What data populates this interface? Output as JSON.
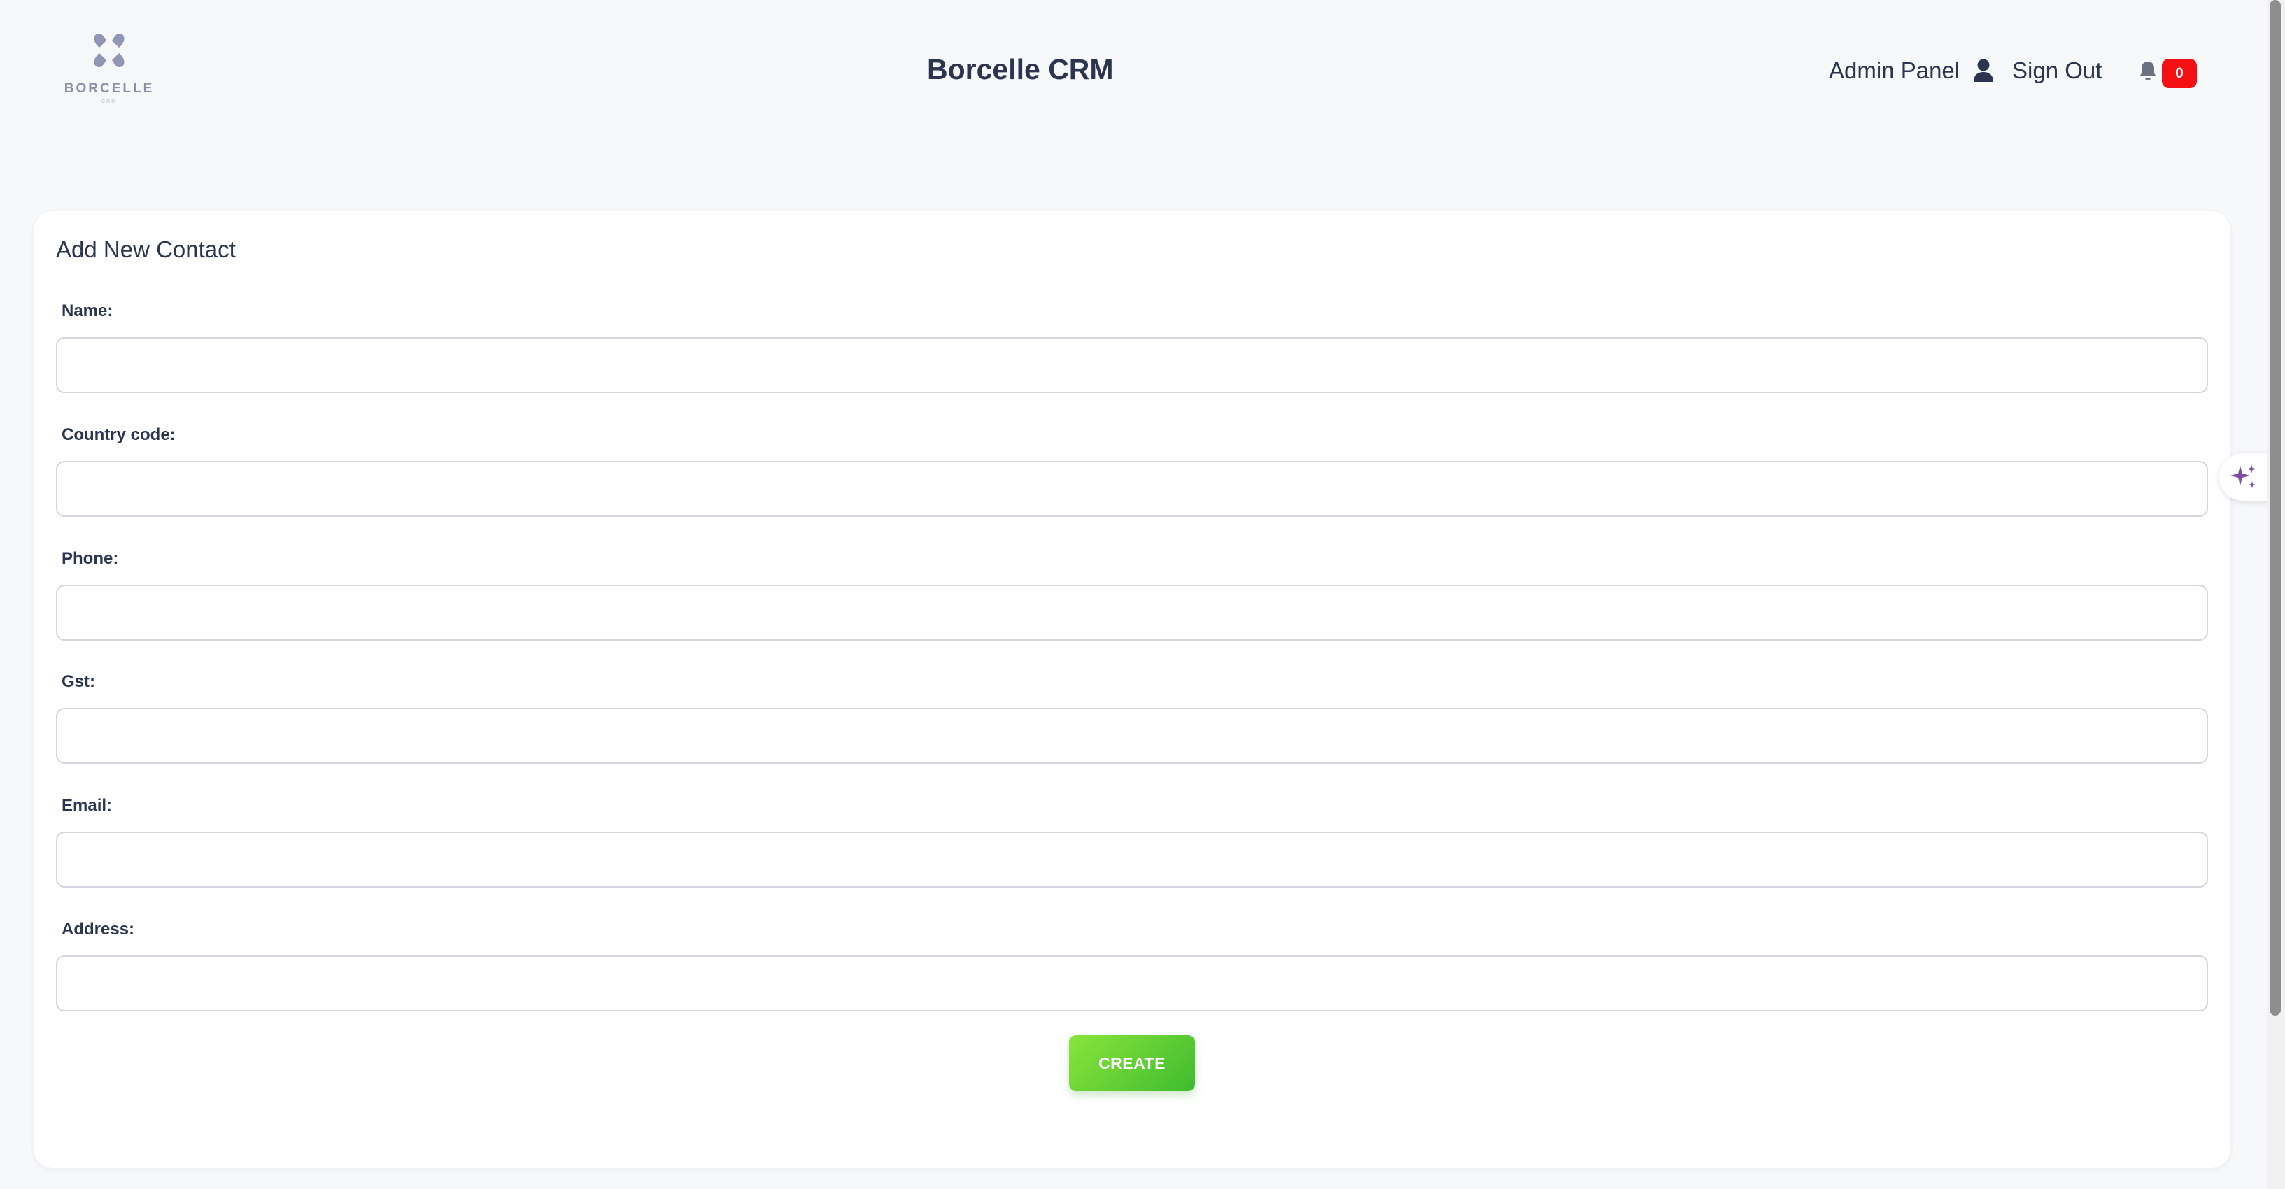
{
  "header": {
    "logo_text": "BORCELLE",
    "logo_subtext": "CRM",
    "title": "Borcelle CRM",
    "admin_panel": "Admin Panel",
    "sign_out": "Sign Out",
    "notification_count": "0"
  },
  "form": {
    "title": "Add New Contact",
    "fields": [
      {
        "label": "Name:",
        "value": "",
        "placeholder": ""
      },
      {
        "label": "Country code:",
        "value": "",
        "placeholder": ""
      },
      {
        "label": "Phone:",
        "value": "",
        "placeholder": ""
      },
      {
        "label": "Gst:",
        "value": "",
        "placeholder": ""
      },
      {
        "label": "Email:",
        "value": "",
        "placeholder": ""
      },
      {
        "label": "Address:",
        "value": "",
        "placeholder": ""
      }
    ],
    "submit_label": "CREATE"
  },
  "icons": {
    "user": "user-icon",
    "bell": "bell-icon",
    "assistant": "sparkles-icon"
  },
  "colors": {
    "text": "#2b3550",
    "badge": "#f30f12",
    "create_button_start": "#8ae53b",
    "create_button_end": "#3fbb2f",
    "logo": "#8a90aa",
    "sparkle": "#7b4fa6"
  }
}
